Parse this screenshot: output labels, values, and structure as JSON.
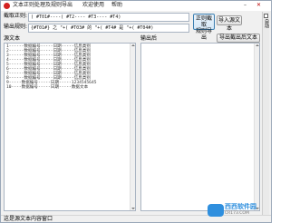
{
  "window": {
    "title": "文本正则处理及规则导出",
    "menu": [
      "欢迎使用",
      "帮助"
    ]
  },
  "form": {
    "split_label": "截取正则:",
    "split_value": "( #T01#----( #T2---- #T3---- #T4)",
    "output_label": "输出规则:",
    "output_value": "{#T01#} 之 \"+( #T03# 的 \"+( #T4# 是 \"+( #T04#)"
  },
  "buttons": {
    "regex": "正则截取\n规则导出",
    "import": "导入源文本",
    "export": "导出截出后文本"
  },
  "panes": {
    "source_label": "源文本",
    "result_label": "输出后"
  },
  "source_lines": [
    "1------数据编号-----日期-----信息类别",
    "2------数据编号-----日期-----信息类别",
    "3------数据编号-----日期-----信息类别",
    "4------数据编号-----日期-----信息类别",
    "5------数据编号-----日期-----信息类别",
    "6------数据编号-----日期-----信息类别",
    "7------数据编号-----日期-----信息类别",
    "8------数据编号-----日期-----信息类别",
    "9-----数据编号-----日期-----1234545645",
    "10----数据编号-----日期-----数据文本"
  ],
  "sidebar": {
    "label": "自动"
  },
  "status": {
    "text": "这是源文本内容窗口"
  },
  "watermark": {
    "name": "西西软件园",
    "url": "CR173.COM"
  }
}
